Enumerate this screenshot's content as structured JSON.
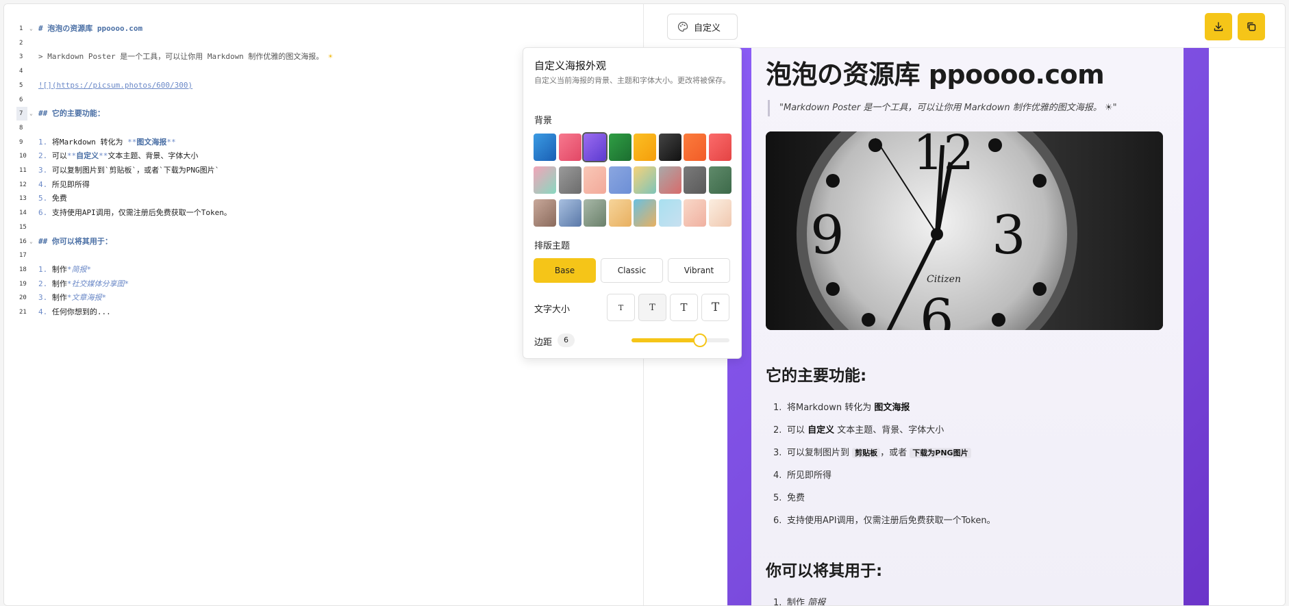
{
  "editor": {
    "lines": [
      {
        "n": "1",
        "fold": true,
        "parts": [
          [
            "md-head",
            "# 泡泡の资源库 ppoooo.com"
          ]
        ]
      },
      {
        "n": "2",
        "parts": []
      },
      {
        "n": "3",
        "parts": [
          [
            "md-quote",
            "> Markdown Poster 是一个工具，可以让你用 Markdown 制作优雅的图文海报。 "
          ],
          [
            "sun",
            "☀"
          ]
        ]
      },
      {
        "n": "4",
        "parts": []
      },
      {
        "n": "5",
        "parts": [
          [
            "md-link",
            "![](https://picsum.photos/600/300)"
          ]
        ]
      },
      {
        "n": "6",
        "parts": []
      },
      {
        "n": "7",
        "fold": true,
        "hl": true,
        "parts": [
          [
            "md-head",
            "## 它的主要功能："
          ]
        ]
      },
      {
        "n": "8",
        "parts": []
      },
      {
        "n": "9",
        "parts": [
          [
            "md-mark",
            "1. "
          ],
          [
            "",
            "将Markdown 转化为 "
          ],
          [
            "md-mark",
            "**"
          ],
          [
            "md-bold",
            "图文海报"
          ],
          [
            "md-mark",
            "**"
          ]
        ]
      },
      {
        "n": "10",
        "parts": [
          [
            "md-mark",
            "2. "
          ],
          [
            "",
            "可以"
          ],
          [
            "md-mark",
            "**"
          ],
          [
            "md-bold",
            "自定义"
          ],
          [
            "md-mark",
            "**"
          ],
          [
            "",
            "文本主题、背景、字体大小"
          ]
        ]
      },
      {
        "n": "11",
        "parts": [
          [
            "md-mark",
            "3. "
          ],
          [
            "",
            "可以复制图片到`剪贴板`，或者`下载为PNG图片`"
          ]
        ]
      },
      {
        "n": "12",
        "parts": [
          [
            "md-mark",
            "4. "
          ],
          [
            "",
            "所见即所得"
          ]
        ]
      },
      {
        "n": "13",
        "parts": [
          [
            "md-mark",
            "5. "
          ],
          [
            "",
            "免费"
          ]
        ]
      },
      {
        "n": "14",
        "parts": [
          [
            "md-mark",
            "6. "
          ],
          [
            "",
            "支持使用API调用，仅需注册后免费获取一个Token。"
          ]
        ]
      },
      {
        "n": "15",
        "parts": []
      },
      {
        "n": "16",
        "fold": true,
        "parts": [
          [
            "md-head",
            "## 你可以将其用于："
          ]
        ]
      },
      {
        "n": "17",
        "parts": []
      },
      {
        "n": "18",
        "parts": [
          [
            "md-mark",
            "1. "
          ],
          [
            "",
            "制作"
          ],
          [
            "md-em",
            "*简报*"
          ]
        ]
      },
      {
        "n": "19",
        "parts": [
          [
            "md-mark",
            "2. "
          ],
          [
            "",
            "制作"
          ],
          [
            "md-em",
            "*社交媒体分享图*"
          ]
        ]
      },
      {
        "n": "20",
        "parts": [
          [
            "md-mark",
            "3. "
          ],
          [
            "",
            "制作"
          ],
          [
            "md-em",
            "*文章海报*"
          ]
        ]
      },
      {
        "n": "21",
        "parts": [
          [
            "md-mark",
            "4. "
          ],
          [
            "",
            "任何你想到的..."
          ]
        ]
      }
    ]
  },
  "toolbar": {
    "custom_label": "自定义",
    "palette_icon": "palette-icon",
    "download_icon": "download-icon",
    "copy_icon": "copy-icon",
    "accent": "#f5c518"
  },
  "popover": {
    "title": "自定义海报外观",
    "description": "自定义当前海报的背景、主题和字体大小。更改将被保存。",
    "background_label": "背景",
    "theme_label": "排版主题",
    "font_size_label": "文字大小",
    "margin_label": "边距",
    "margin_value": "6",
    "margin_fraction": 0.7,
    "themes": [
      "Base",
      "Classic",
      "Vibrant"
    ],
    "active_theme": "Base",
    "active_size": 1,
    "selected_background": 2,
    "swatches_row1": [
      "linear-gradient(135deg,#3b9be3,#1a5fb4)",
      "linear-gradient(135deg,#f7788e,#e24866)",
      "linear-gradient(135deg,#9c6cf0,#5c3bd0)",
      "linear-gradient(135deg,#2f9e44,#1c6e30)",
      "linear-gradient(135deg,#fbbf24,#f59e0b)",
      "linear-gradient(135deg,#444,#111)",
      "linear-gradient(135deg,#fb7c3c,#f25c28)",
      "linear-gradient(135deg,#fb6b6b,#e44444)"
    ],
    "swatches_row2": [
      "linear-gradient(135deg,#f2a4b8,#88d8c0)",
      "linear-gradient(135deg,#9a9a9a,#6c6c6c)",
      "linear-gradient(135deg,#f9c7b6,#f2a99a)",
      "linear-gradient(135deg,#8aa6e0,#6d8fd6)",
      "linear-gradient(135deg,#f6d27a,#7ec4b8)",
      "linear-gradient(135deg,#a9a9a9,#d86b6b)",
      "linear-gradient(135deg,#7a7a7a,#5a5a5a)",
      "linear-gradient(135deg,#5f8a6a,#3d6a4a)"
    ],
    "swatches_row3": [
      "linear-gradient(135deg,#c8a89a,#8a6a5c)",
      "linear-gradient(135deg,#a8c0e0,#5a78a8)",
      "linear-gradient(135deg,#a8b8a8,#6a806a)",
      "linear-gradient(135deg,#f6d49a,#e8b060)",
      "linear-gradient(135deg,#6ac0e0,#e8b060)",
      "linear-gradient(135deg,#a8e0f0,#c8e0f0)",
      "linear-gradient(135deg,#f8d8c8,#f0b0a0)",
      "linear-gradient(135deg,#fbeee0,#f0c8b0)"
    ]
  },
  "poster": {
    "title": "泡泡の资源库 ppoooo.com",
    "quote": "\"Markdown Poster 是一个工具，可以让你用 Markdown 制作优雅的图文海报。 ☀\"",
    "image_alt": "clock image",
    "h2_features": "它的主要功能:",
    "h2_uses": "你可以将其用于:",
    "features": [
      {
        "num": "1.",
        "segs": [
          [
            "t",
            "将Markdown 转化为 "
          ],
          [
            "b",
            "图文海报"
          ]
        ]
      },
      {
        "num": "2.",
        "segs": [
          [
            "t",
            "可以 "
          ],
          [
            "b",
            "自定义"
          ],
          [
            "t",
            " 文本主题、背景、字体大小"
          ]
        ]
      },
      {
        "num": "3.",
        "segs": [
          [
            "t",
            "可以复制图片到 "
          ],
          [
            "c",
            "剪贴板"
          ],
          [
            "t",
            "，或者 "
          ],
          [
            "c",
            "下载为PNG图片"
          ]
        ]
      },
      {
        "num": "4.",
        "segs": [
          [
            "t",
            "所见即所得"
          ]
        ]
      },
      {
        "num": "5.",
        "segs": [
          [
            "t",
            "免费"
          ]
        ]
      },
      {
        "num": "6.",
        "segs": [
          [
            "t",
            "支持使用API调用，仅需注册后免费获取一个Token。"
          ]
        ]
      }
    ],
    "uses": [
      {
        "num": "1.",
        "segs": [
          [
            "t",
            "制作 "
          ],
          [
            "i",
            "简报"
          ]
        ]
      }
    ]
  }
}
